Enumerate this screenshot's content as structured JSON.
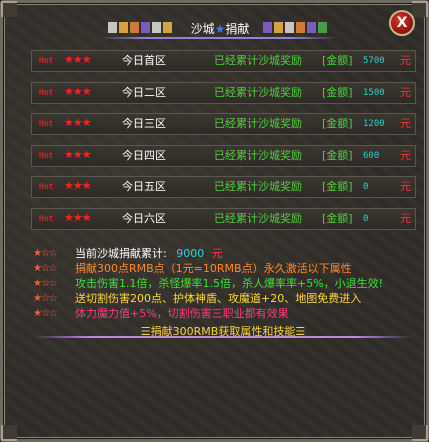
{
  "title": {
    "prefix": "沙城",
    "star": "★",
    "suffix": "捐献"
  },
  "close_label": "X",
  "rows": [
    {
      "hot": "Hot",
      "stars": "★★★",
      "zone": "今日首区",
      "desc": "已经累计沙城奖励",
      "amount_label": "[金额]",
      "amount": "5700",
      "unit": "元"
    },
    {
      "hot": "Hot",
      "stars": "★★★",
      "zone": "今日二区",
      "desc": "已经累计沙城奖励",
      "amount_label": "[金额]",
      "amount": "1500",
      "unit": "元"
    },
    {
      "hot": "Hot",
      "stars": "★★★",
      "zone": "今日三区",
      "desc": "已经累计沙城奖励",
      "amount_label": "[金额]",
      "amount": "1200",
      "unit": "元"
    },
    {
      "hot": "Hot",
      "stars": "★★★",
      "zone": "今日四区",
      "desc": "已经累计沙城奖励",
      "amount_label": "[金额]",
      "amount": "600",
      "unit": "元"
    },
    {
      "hot": "Hot",
      "stars": "★★★",
      "zone": "今日五区",
      "desc": "已经累计沙城奖励",
      "amount_label": "[金额]",
      "amount": "0",
      "unit": "元"
    },
    {
      "hot": "Hot",
      "stars": "★★★",
      "zone": "今日六区",
      "desc": "已经累计沙城奖励",
      "amount_label": "[金额]",
      "amount": "0",
      "unit": "元"
    }
  ],
  "info": {
    "stars": "★☆☆",
    "total_label": "当前沙城捐献累计:",
    "total_value": "9000",
    "total_unit": "元",
    "line2": "捐献300点RMB点（1元=10RMB点）永久激活以下属性",
    "line3": "攻击伤害1.1倍，杀怪爆率1.5倍，杀人爆率率+5%，小退生效!",
    "line4": "送切割伤害200点、护体神盾、攻魔道+20、地图免费进入",
    "line5": "体力魔力值+5%，切割伤害三职业都有效果"
  },
  "bottom_action": "☰捐献300RMB获取属性和技能☰",
  "colors": {
    "accent_red": "#ff2a2a",
    "green_text": "#4cd33c",
    "cyan_value": "#27d3d3",
    "gold_text": "#ffd23a"
  }
}
